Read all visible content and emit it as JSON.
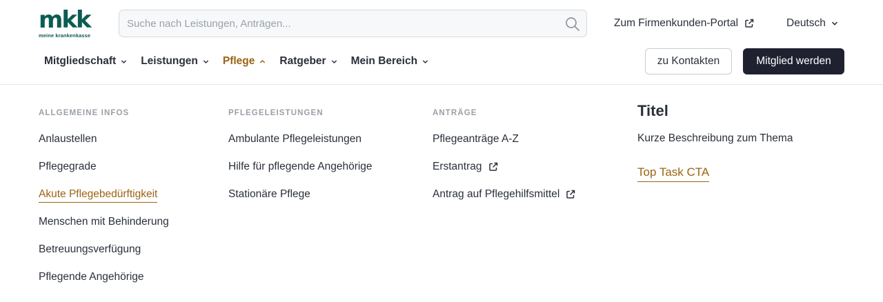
{
  "brand": {
    "logo_text": "mkk",
    "logo_subtitle": "meine krankenkasse",
    "color": "#0d5c52"
  },
  "search": {
    "placeholder": "Suche nach Leistungen, Anträgen...",
    "value": ""
  },
  "header": {
    "portal_link": "Zum Firmenkunden-Portal",
    "language": "Deutsch"
  },
  "nav": {
    "items": [
      {
        "label": "Mitgliedschaft",
        "state": "collapsed"
      },
      {
        "label": "Leistungen",
        "state": "collapsed"
      },
      {
        "label": "Pflege",
        "state": "expanded"
      },
      {
        "label": "Ratgeber",
        "state": "collapsed"
      },
      {
        "label": "Mein Bereich",
        "state": "collapsed"
      }
    ]
  },
  "actions": {
    "contacts_label": "zu Kontakten",
    "join_label": "Mitglied werden"
  },
  "megamenu": {
    "columns": [
      {
        "heading": "ALLGEMEINE INFOS",
        "items": [
          {
            "label": "Anlaustellen"
          },
          {
            "label": "Pflegegrade"
          },
          {
            "label": "Akute Pflegebedürftigkeit",
            "active": true
          },
          {
            "label": "Menschen mit Behinderung"
          },
          {
            "label": "Betreuungsverfügung"
          },
          {
            "label": "Pflegende Angehörige"
          }
        ]
      },
      {
        "heading": "PFLEGELEISTUNGEN",
        "items": [
          {
            "label": "Ambulante Pflegeleistungen"
          },
          {
            "label": "Hilfe für pflegende Angehörige"
          },
          {
            "label": "Stationäre Pflege"
          }
        ]
      },
      {
        "heading": "ANTRÄGE",
        "items": [
          {
            "label": "Pflegeanträge A-Z"
          },
          {
            "label": "Erstantrag",
            "external": true
          },
          {
            "label": "Antrag auf Pflegehilfsmittel",
            "external": true
          }
        ]
      }
    ],
    "feature": {
      "title": "Titel",
      "description": "Kurze Beschreibung zum Thema",
      "cta": "Top Task CTA"
    }
  },
  "colors": {
    "accent": "#9a6412",
    "text": "#2a2f3a",
    "primary_button": "#1f2130",
    "muted": "#9aa0a8"
  },
  "icons": {
    "search": "search-icon",
    "external": "external-link-icon",
    "chevron": "chevron-down-icon",
    "chevron_up": "chevron-up-icon"
  }
}
